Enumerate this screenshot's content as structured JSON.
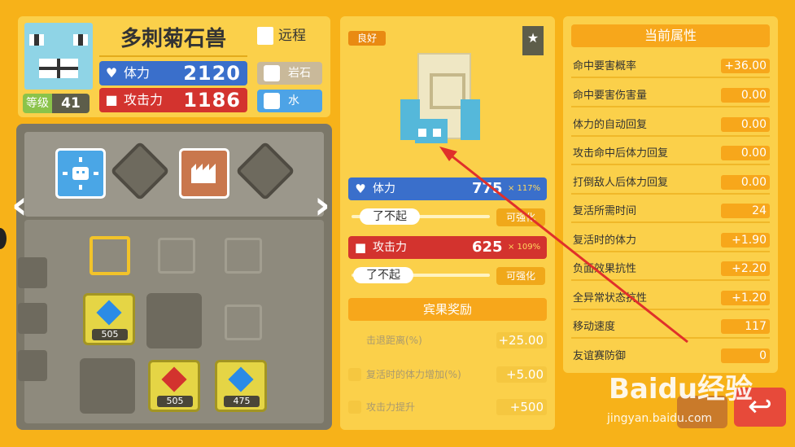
{
  "monster": {
    "name": "多刺菊石兽",
    "range_label": "远程",
    "level_label": "等级",
    "level": "41",
    "hp_label": "体力",
    "hp": "2120",
    "atk_label": "攻击力",
    "atk": "1186",
    "type1": "岩石",
    "type2": "水"
  },
  "board": {
    "gems": [
      {
        "value": "505",
        "color": "#2b8be6"
      },
      {
        "value": "505",
        "color": "#d3332e"
      },
      {
        "value": "475",
        "color": "#2b8be6"
      }
    ]
  },
  "center": {
    "quality_tag": "良好",
    "hp_label": "体力",
    "hp_value": "775",
    "hp_percent": "× 117%",
    "hp_rank": "了不起",
    "hp_enhance": "可强化",
    "atk_label": "攻击力",
    "atk_value": "625",
    "atk_percent": "× 109%",
    "atk_rank": "了不起",
    "atk_enhance": "可强化",
    "bonus_title": "宾果奖励",
    "bonus": [
      {
        "name": "击退距离(%)",
        "value": "+25.00"
      },
      {
        "name": "复活时的体力增加(%)",
        "value": "+5.00"
      },
      {
        "name": "攻击力提升",
        "value": "+500"
      }
    ]
  },
  "attributes": {
    "title": "当前属性",
    "items": [
      {
        "name": "命中要害概率",
        "value": "+36.00"
      },
      {
        "name": "命中要害伤害量",
        "value": "0.00"
      },
      {
        "name": "体力的自动回复",
        "value": "0.00"
      },
      {
        "name": "攻击命中后体力回复",
        "value": "0.00"
      },
      {
        "name": "打倒敌人后体力回复",
        "value": "0.00"
      },
      {
        "name": "复活所需时间",
        "value": "24"
      },
      {
        "name": "复活时的体力",
        "value": "+1.90"
      },
      {
        "name": "负面效果抗性",
        "value": "+2.20"
      },
      {
        "name": "全异常状态抗性",
        "value": "+1.20"
      },
      {
        "name": "移动速度",
        "value": "117"
      },
      {
        "name": "友谊赛防御",
        "value": "0"
      }
    ]
  },
  "watermark": {
    "main": "Baidu经验",
    "sub": "jingyan.baidu.com"
  },
  "colors": {
    "background": "#f7b219",
    "panel": "#fbd04a",
    "accent": "#f7a71b",
    "hp": "#3a6fcb",
    "atk": "#d3332e",
    "annotation": "#e0302a"
  }
}
